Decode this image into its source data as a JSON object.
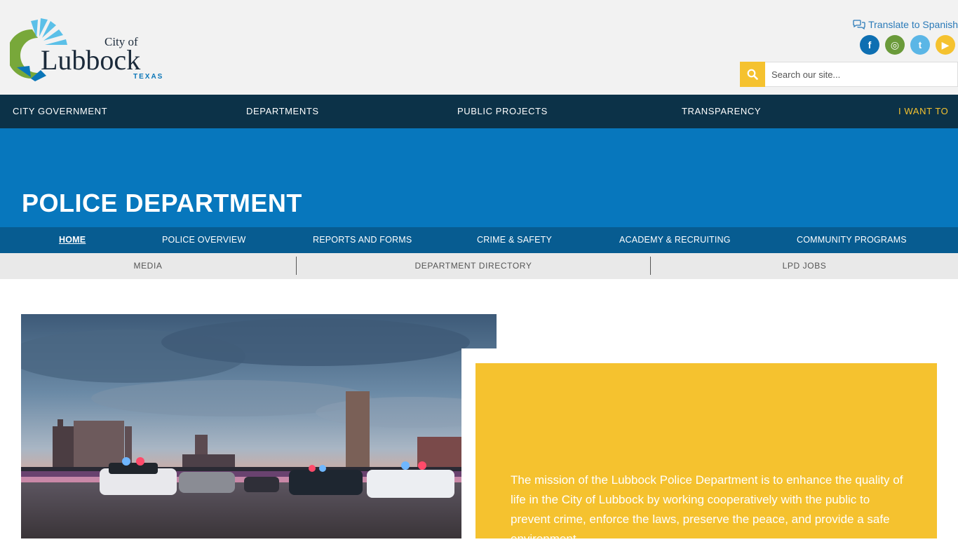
{
  "header": {
    "logo": {
      "city_of": "City of",
      "name": "Lubbock",
      "state": "TEXAS"
    },
    "translate_label": "Translate to Spanish",
    "social": [
      {
        "name": "facebook-icon",
        "glyph": "f",
        "color": "#0e6fb2"
      },
      {
        "name": "instagram-icon",
        "glyph": "◎",
        "color": "#6a9a3a"
      },
      {
        "name": "twitter-icon",
        "glyph": "t",
        "color": "#5bb6e6"
      },
      {
        "name": "youtube-icon",
        "glyph": "▶",
        "color": "#f5c22f"
      }
    ],
    "search": {
      "placeholder": "Search our site..."
    }
  },
  "main_nav": {
    "items": [
      "CITY GOVERNMENT",
      "DEPARTMENTS",
      "PUBLIC PROJECTS",
      "TRANSPARENCY",
      "I WANT TO"
    ]
  },
  "banner": {
    "title": "POLICE DEPARTMENT"
  },
  "sub_nav": {
    "items": [
      "HOME",
      "POLICE OVERVIEW",
      "REPORTS AND FORMS",
      "CRIME & SAFETY",
      "ACADEMY & RECRUITING",
      "COMMUNITY PROGRAMS"
    ]
  },
  "third_nav": {
    "items": [
      "MEDIA",
      "DEPARTMENT DIRECTORY",
      "LPD JOBS"
    ]
  },
  "mission": {
    "text": "The mission of the Lubbock Police Department is to enhance the quality of life in the City of Lubbock by working cooperatively with the public to prevent crime, enforce the laws, preserve the peace, and provide a safe environment."
  },
  "colors": {
    "header_bg": "#f2f2f2",
    "main_nav_bg": "#0c3248",
    "banner_bg": "#0777bd",
    "sub_nav_bg": "#075c91",
    "accent_yellow": "#f5c22f"
  }
}
